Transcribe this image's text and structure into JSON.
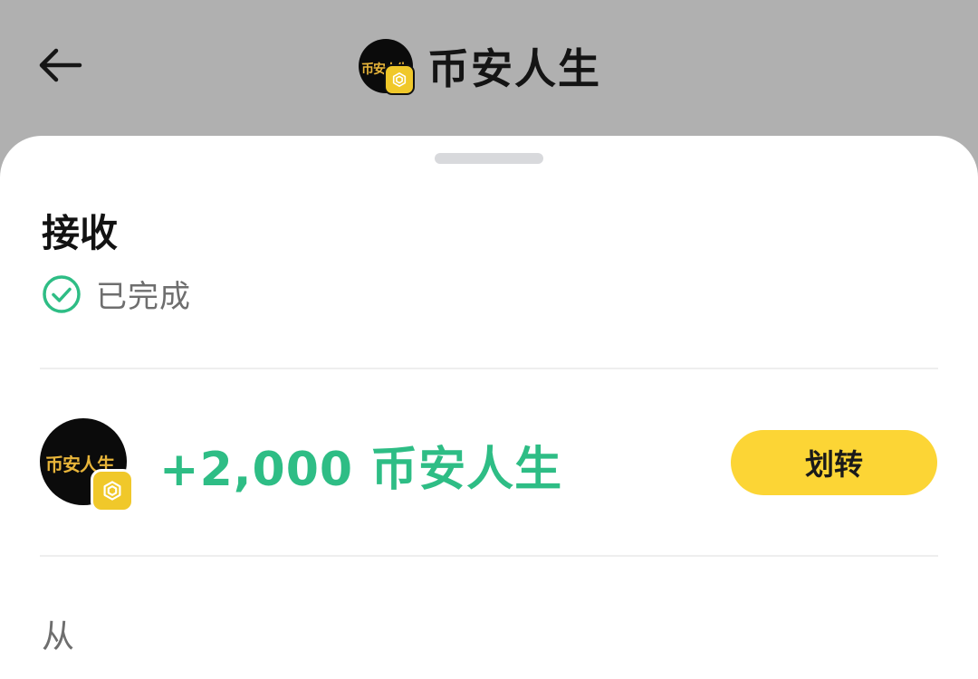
{
  "header": {
    "title": "币安人生",
    "avatar_text": "币安人生",
    "back_icon": "arrow-left-icon"
  },
  "transaction": {
    "type_label": "接收",
    "status_label": "已完成",
    "status_icon": "check-circle-icon",
    "amount": "+2,000 币安人生",
    "token_avatar_text": "币安人生",
    "transfer_button_label": "划转",
    "from_label": "从"
  },
  "colors": {
    "accent_yellow": "#fcd535",
    "success_green": "#2ebd85",
    "overlay_gray": "#b0b0b0"
  }
}
